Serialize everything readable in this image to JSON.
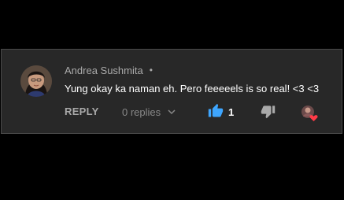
{
  "comment": {
    "author": "Andrea Sushmita",
    "separator": "•",
    "text": "Yung okay ka naman eh. Pero feeeeels is so real! <3 <3",
    "reply_label": "REPLY",
    "replies_label": "0 replies",
    "like_count": "1",
    "icons": {
      "avatar": "avatar",
      "like": "thumbs-up-icon",
      "dislike": "thumbs-down-icon",
      "expand": "chevron-down-icon",
      "creator_heart": "creator-heart-icon"
    }
  },
  "colors": {
    "background": "#000000",
    "card": "#282828",
    "like_active": "#3ea6ff",
    "heart": "#ff3b47",
    "muted_text": "#aaaaaa"
  }
}
